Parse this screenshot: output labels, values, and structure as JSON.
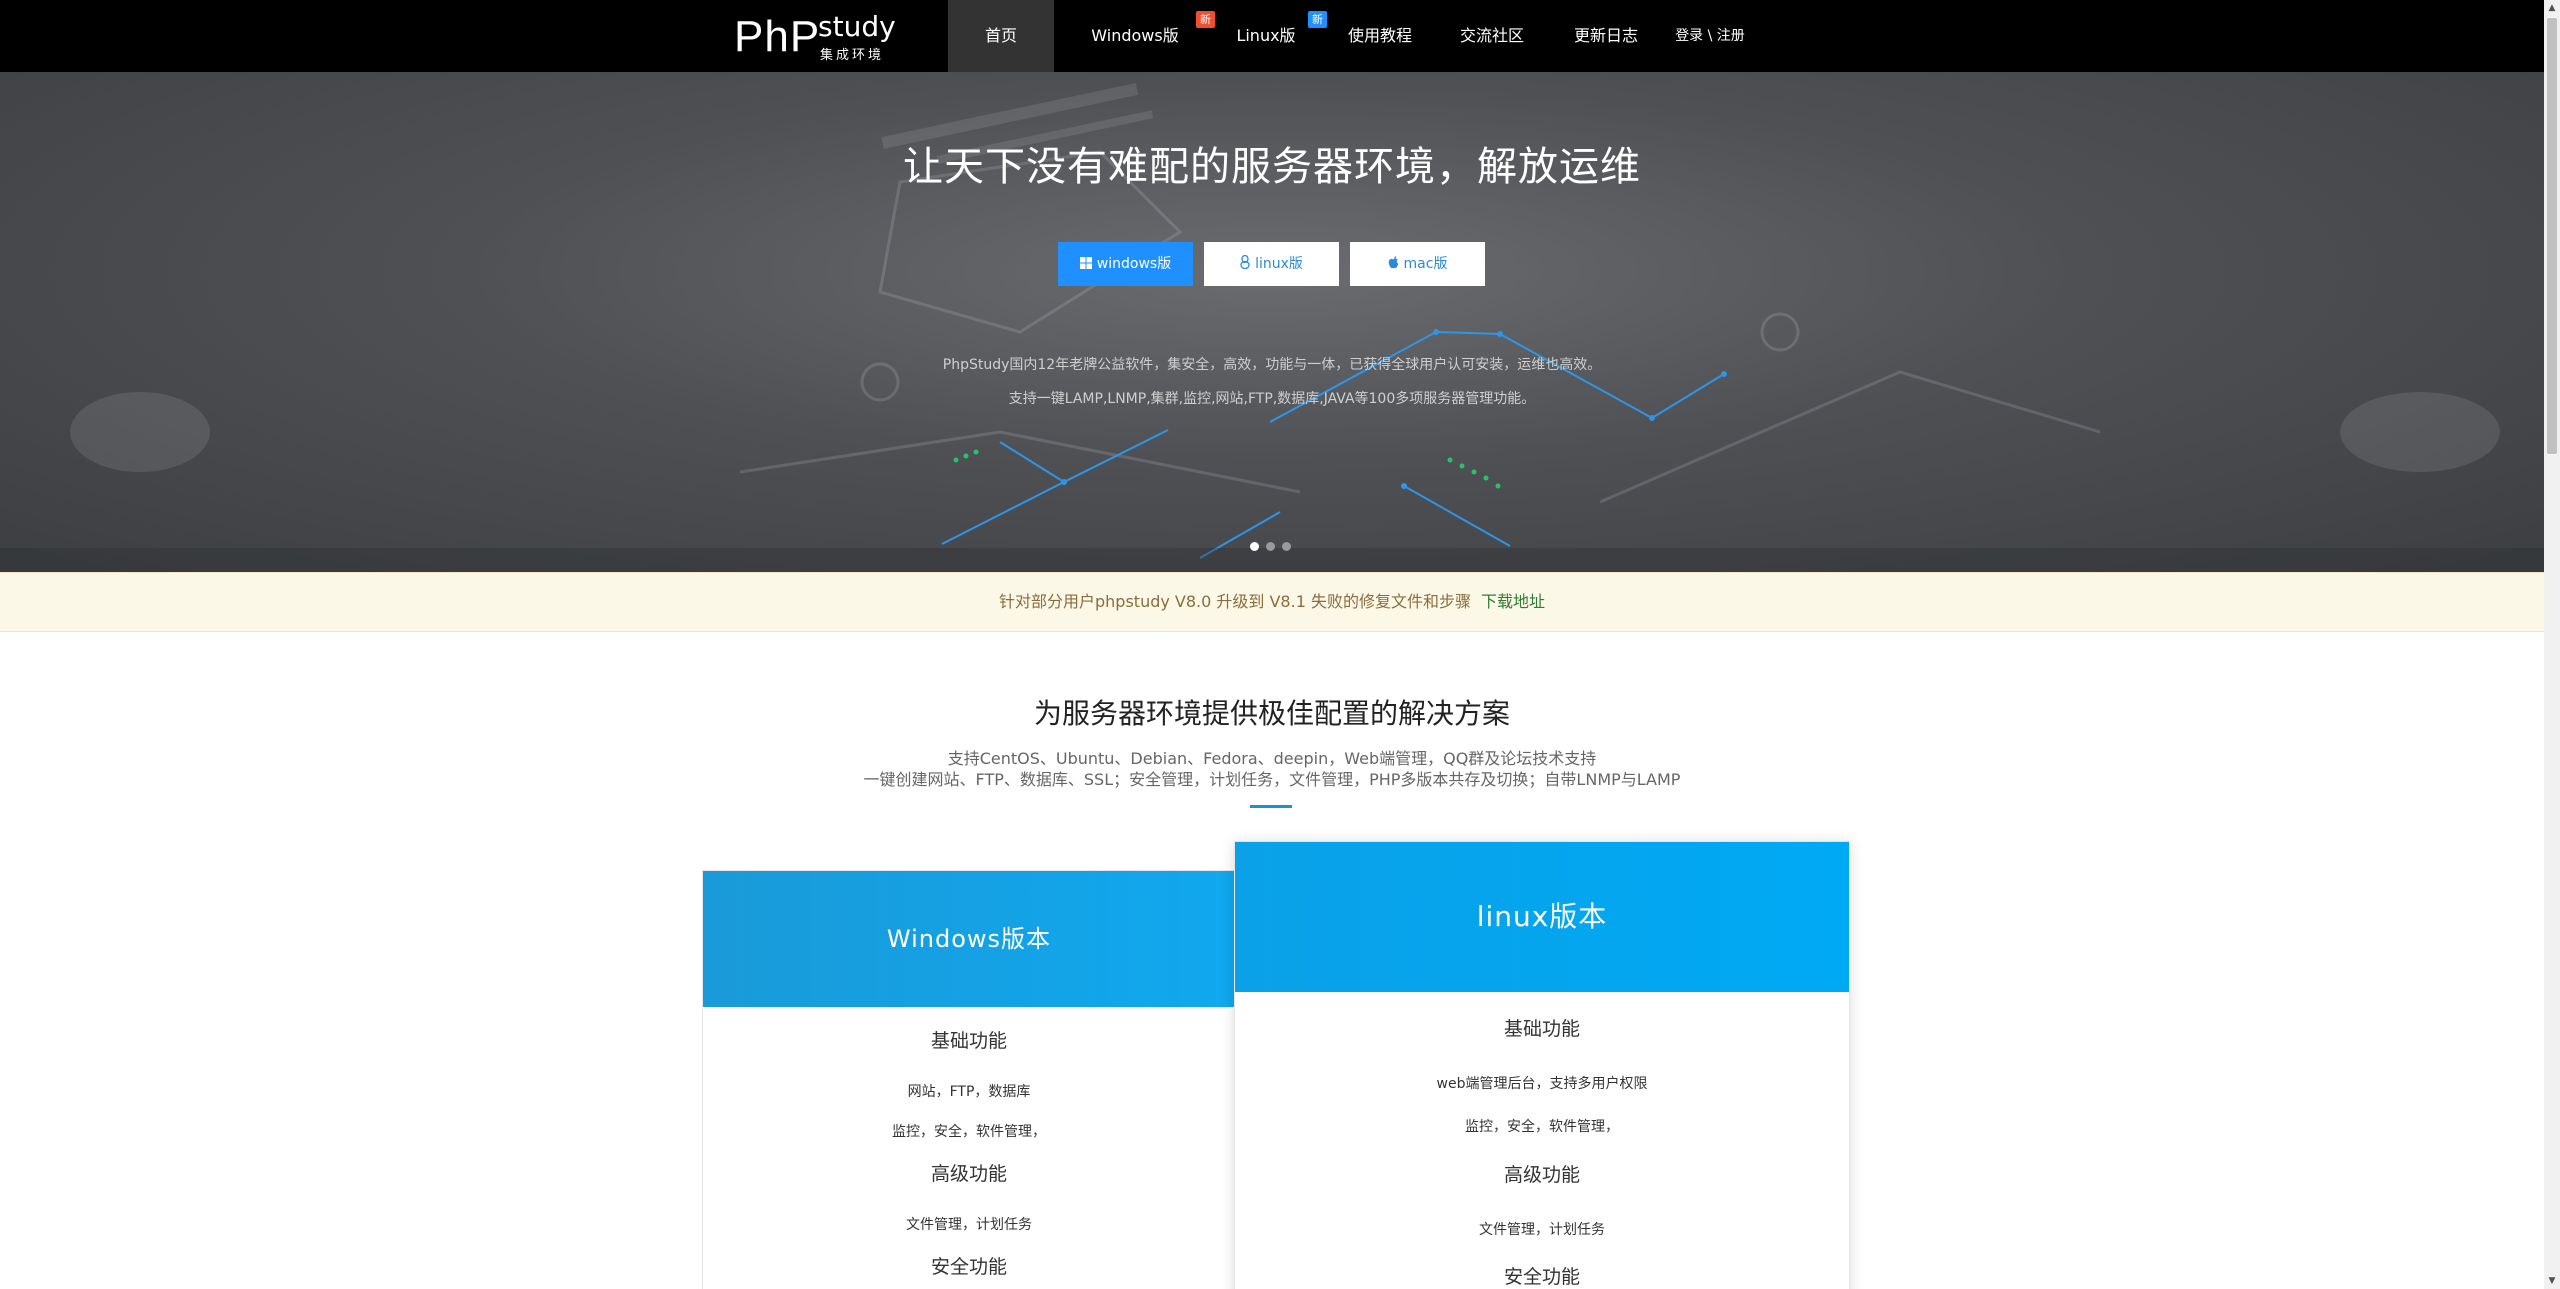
{
  "nav": {
    "logo": {
      "php": "PhP",
      "study": "study",
      "sub": "集成环境"
    },
    "items": [
      {
        "label": "首页"
      },
      {
        "label": "Windows版",
        "badge": "新",
        "badge_color": "#f05030"
      },
      {
        "label": "Linux版",
        "badge": "新",
        "badge_color": "#1e90ff"
      },
      {
        "label": "使用教程"
      },
      {
        "label": "交流社区"
      },
      {
        "label": "更新日志"
      }
    ],
    "login": "登录 \\ 注册"
  },
  "hero": {
    "title": "让天下没有难配的服务器环境，解放运维",
    "buttons": [
      {
        "label": "windows版",
        "icon": "windows-icon"
      },
      {
        "label": "linux版",
        "icon": "linux-icon"
      },
      {
        "label": "mac版",
        "icon": "apple-icon"
      }
    ],
    "desc1": "PhpStudy国内12年老牌公益软件，集安全，高效，功能与一体，已获得全球用户认可安装，运维也高效。",
    "desc2": "支持一键LAMP,LNMP,集群,监控,网站,FTP,数据库,JAVA等100多项服务器管理功能。",
    "slides": 3,
    "active_slide": 1
  },
  "notice": {
    "text": "针对部分用户phpstudy V8.0 升级到 V8.1 失败的修复文件和步骤",
    "link": "下载地址"
  },
  "solutions": {
    "title": "为服务器环境提供极佳配置的解决方案",
    "sub1": "支持CentOS、Ubuntu、Debian、Fedora、deepin，Web端管理，QQ群及论坛技术支持",
    "sub2": "一键创建网站、FTP、数据库、SSL；安全管理，计划任务，文件管理，PHP多版本共存及切换；自带LNMP与LAMP"
  },
  "cards": {
    "windows": {
      "title": "Windows版本",
      "h1": "基础功能",
      "l1": "网站，FTP，数据库",
      "l2": "监控，安全，软件管理，",
      "h2": "高级功能",
      "l3": "文件管理，计划任务",
      "h3": "安全功能"
    },
    "linux": {
      "title": "linux版本",
      "h1": "基础功能",
      "l1": "web端管理后台，支持多用户权限",
      "l2": "监控，安全，软件管理，",
      "h2": "高级功能",
      "l3": "文件管理，计划任务",
      "h3": "安全功能"
    }
  },
  "colors": {
    "primary": "#1e90ff",
    "card_head": "#10a8ef",
    "notice_bg": "#fcf8e8",
    "notice_link": "#2e7d32",
    "nav_bg": "#000000"
  }
}
